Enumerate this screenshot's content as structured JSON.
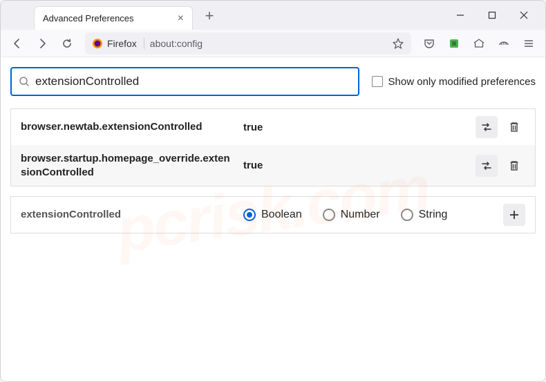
{
  "tab": {
    "title": "Advanced Preferences"
  },
  "url_bar": {
    "identity": "Firefox",
    "url": "about:config"
  },
  "search": {
    "value": "extensionControlled"
  },
  "checkbox_label": "Show only modified preferences",
  "prefs": [
    {
      "name": "browser.newtab.extensionControlled",
      "value": "true"
    },
    {
      "name": "browser.startup.homepage_override.extensionControlled",
      "value": "true"
    }
  ],
  "new_pref": {
    "name": "extensionControlled",
    "types": [
      "Boolean",
      "Number",
      "String"
    ],
    "selected": 0
  },
  "watermark": "pcrisk.com"
}
